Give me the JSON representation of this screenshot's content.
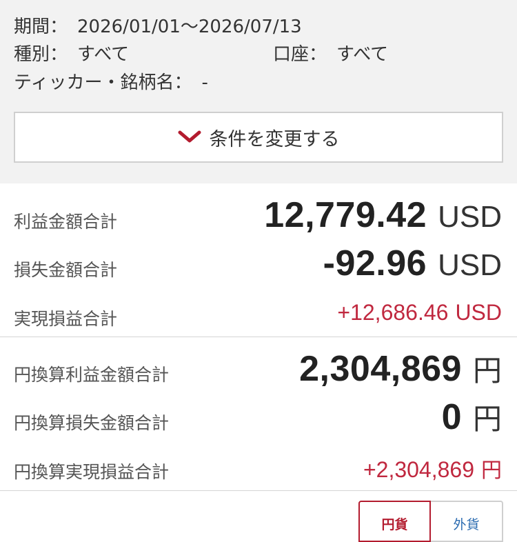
{
  "filters": {
    "period_label": "期間：",
    "period_value": "2026/01/01〜2026/07/13",
    "type_label": "種別：",
    "type_value": "すべて",
    "account_label": "口座：",
    "account_value": "すべて",
    "ticker_label": "ティッカー・銘柄名：",
    "ticker_value": "-"
  },
  "change_button": {
    "icon": "chevron-down-icon",
    "label": "条件を変更する"
  },
  "usd": {
    "profit_label": "利益金額合計",
    "profit_value": "12,779.42",
    "profit_unit": "USD",
    "loss_label": "損失金額合計",
    "loss_value": "-92.96",
    "loss_unit": "USD",
    "realized_label": "実現損益合計",
    "realized_value": "+12,686.46",
    "realized_unit": "USD"
  },
  "jpy": {
    "profit_label": "円換算利益金額合計",
    "profit_value": "2,304,869",
    "profit_unit": "円",
    "loss_label": "円換算損失金額合計",
    "loss_value": "0",
    "loss_unit": "円",
    "realized_label": "円換算実現損益合計",
    "realized_value": "+2,304,869",
    "realized_unit": "円"
  },
  "currency_toggle": {
    "yen_label": "円貨",
    "foreign_label": "外貨",
    "selected": "円貨"
  },
  "colors": {
    "accent_red": "#c0283f",
    "chevron_red": "#b31b2e",
    "link_blue": "#2a6bb0",
    "panel_bg": "#f2f2f2"
  }
}
